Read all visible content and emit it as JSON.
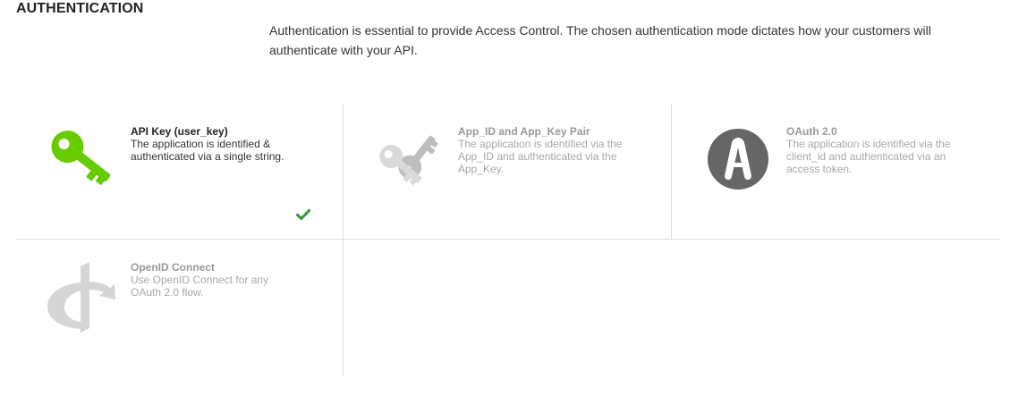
{
  "section": {
    "title": "AUTHENTICATION",
    "description": "Authentication is essential to provide Access Control. The chosen authentication mode dictates how your customers will authenticate with your API."
  },
  "options": [
    {
      "title": "API Key (user_key)",
      "description": "The application is identified & authenticated via a single string.",
      "icon": "key-icon",
      "color": "#66cc00",
      "selected": true
    },
    {
      "title": "App_ID and App_Key Pair",
      "description": "The application is identified via the App_ID and authenticated via the App_Key.",
      "icon": "key-pair-icon",
      "color": "#d0d0d0",
      "selected": false
    },
    {
      "title": "OAuth 2.0",
      "description": "The application is identified via the client_id and authenticated via an access token.",
      "icon": "oauth-icon",
      "color": "#666666",
      "selected": false
    },
    {
      "title": "OpenID Connect",
      "description": "Use OpenID Connect for any OAuth 2.0 flow.",
      "icon": "openid-icon",
      "color": "#d5d5d5",
      "selected": false
    }
  ],
  "selected_indicator": {
    "icon": "checkmark-icon",
    "color": "#339933"
  }
}
